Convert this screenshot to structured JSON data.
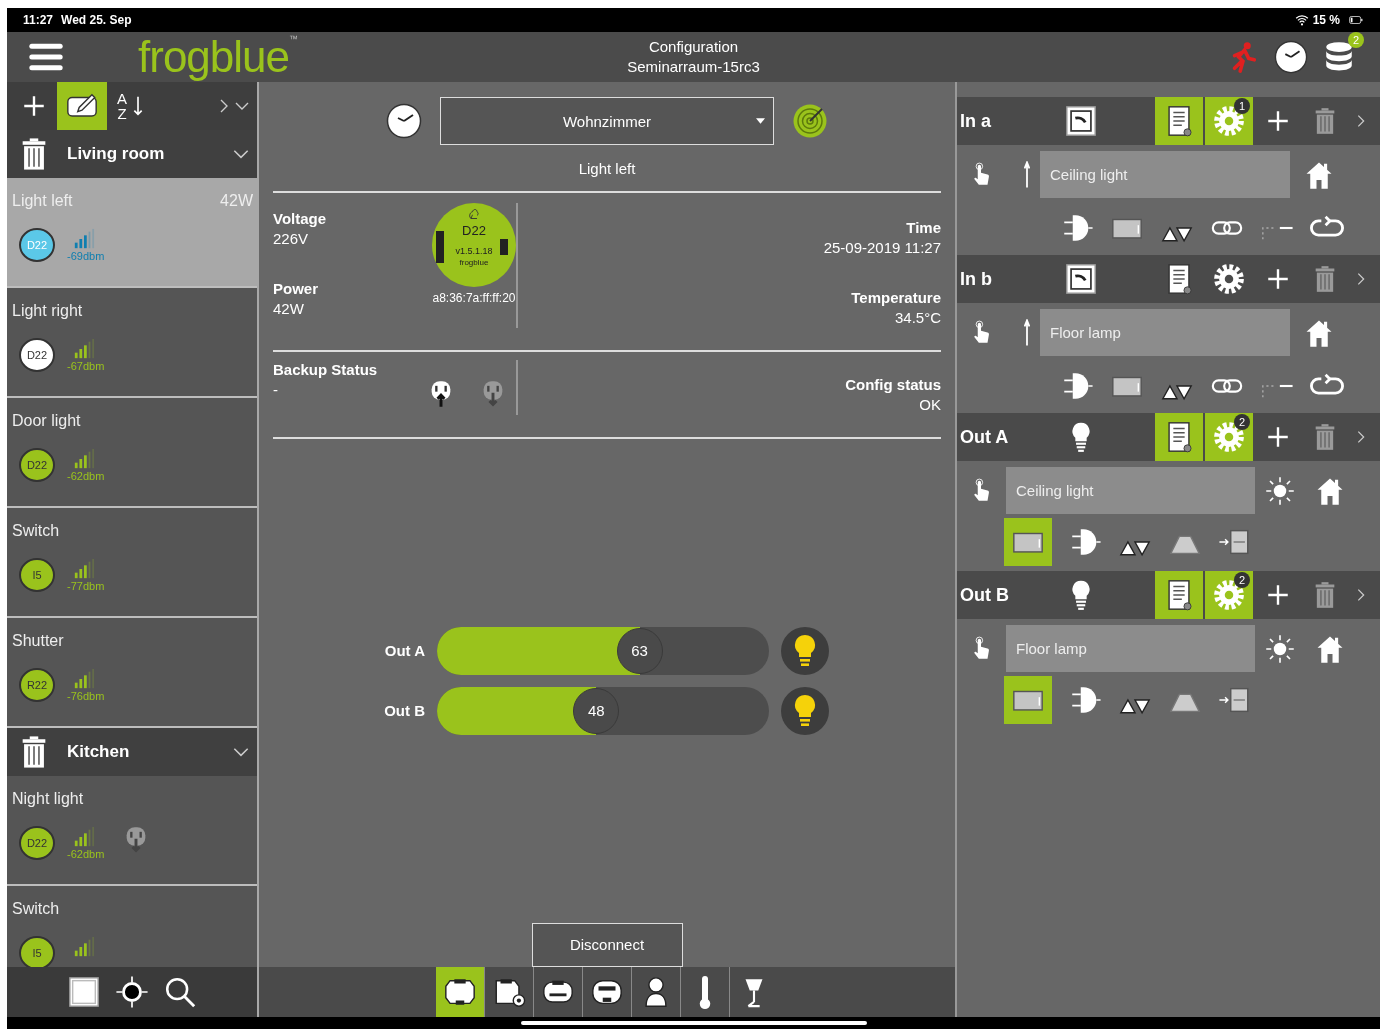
{
  "status_bar": {
    "time": "11:27",
    "date": "Wed 25. Sep",
    "battery": "15 %"
  },
  "header": {
    "logo": "frogblue",
    "trademark": "™",
    "title": "Configuration",
    "subtitle": "Seminarraum-15rc3",
    "badge": "2"
  },
  "sidebar": {
    "toolbar": {
      "edit_selected": true,
      "sort_letters": [
        "A",
        "Z"
      ]
    },
    "groups": [
      {
        "name": "Living room",
        "expanded": true,
        "devices": [
          {
            "name": "Light left",
            "power": "42W",
            "module": "D22",
            "color": "#5bc8e8",
            "signal": "-69dbm",
            "selected": true,
            "plug_icon": false
          },
          {
            "name": "Light right",
            "module": "D22",
            "color": "#ffffff",
            "signal": "-67dbm",
            "selected": false,
            "plug_icon": false
          },
          {
            "name": "Door light",
            "module": "D22",
            "color": "#9ac31c",
            "signal": "-62dbm",
            "selected": false,
            "plug_icon": false
          },
          {
            "name": "Switch",
            "module": "I5",
            "color": "#9ac31c",
            "signal": "-77dbm",
            "selected": false,
            "plug_icon": false
          },
          {
            "name": "Shutter",
            "module": "R22",
            "color": "#9ac31c",
            "signal": "-76dbm",
            "selected": false,
            "plug_icon": false
          }
        ]
      },
      {
        "name": "Kitchen",
        "expanded": true,
        "devices": [
          {
            "name": "Night light",
            "module": "D22",
            "color": "#9ac31c",
            "signal": "-62dbm",
            "selected": false,
            "plug_icon": true
          },
          {
            "name": "Switch",
            "module": "I5",
            "color": "#9ac31c",
            "selected": false,
            "plug_icon": false
          }
        ]
      }
    ]
  },
  "device_panel": {
    "room_select": "Wohnzimmer",
    "device_name": "Light left",
    "info_left": [
      {
        "label": "Voltage",
        "value": "226V"
      },
      {
        "label": "Power",
        "value": "42W"
      }
    ],
    "info_right": [
      {
        "label": "Time",
        "value": "25-09-2019 11:27"
      },
      {
        "label": "Temperature",
        "value": "34.5°C"
      }
    ],
    "module": {
      "model": "D22",
      "version": "v1.5.1.18",
      "brand": "frogblue",
      "mac": "a8:36:7a:ff:ff:20"
    },
    "backup": {
      "label": "Backup Status",
      "value": "-"
    },
    "config": {
      "label": "Config status",
      "value": "OK"
    },
    "outputs": [
      {
        "label": "Out A",
        "reading": "63",
        "level": 0.61
      },
      {
        "label": "Out B",
        "reading": "48",
        "level": 0.48
      }
    ],
    "disconnect": "Disconnect",
    "bottom_tabs": [
      {
        "kind": "module",
        "selected": true
      },
      {
        "kind": "module-settings",
        "selected": false
      },
      {
        "kind": "module-wide",
        "selected": false
      },
      {
        "kind": "module-flat",
        "selected": false
      },
      {
        "kind": "person",
        "selected": false
      },
      {
        "kind": "thermometer",
        "selected": false
      },
      {
        "kind": "lamp",
        "selected": false
      }
    ]
  },
  "channels": [
    {
      "name": "In a",
      "kind": "input",
      "list_active": true,
      "settings_active": true,
      "settings_count": "1",
      "target": "Ceiling light"
    },
    {
      "name": "In b",
      "kind": "input",
      "list_active": false,
      "settings_active": false,
      "target": "Floor lamp"
    },
    {
      "name": "Out A",
      "kind": "output",
      "list_active": true,
      "settings_active": true,
      "settings_count": "2",
      "target": "Ceiling light",
      "panel_selected": true
    },
    {
      "name": "Out B",
      "kind": "output",
      "list_active": true,
      "settings_active": true,
      "settings_count": "2",
      "target": "Floor lamp",
      "panel_selected": true
    }
  ]
}
